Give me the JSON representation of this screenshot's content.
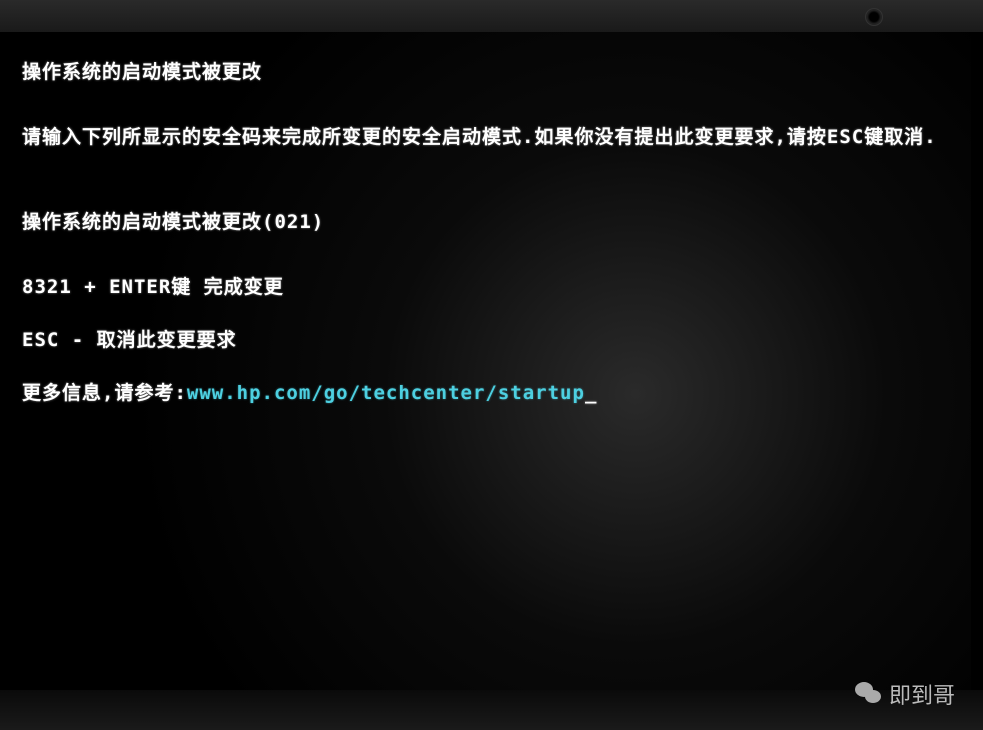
{
  "bios": {
    "title": "操作系统的启动模式被更改",
    "instruction": "请输入下列所显示的安全码来完成所变更的安全启动模式.如果你没有提出此变更要求,请按ESC键取消.",
    "status_line": "操作系统的启动模式被更改(021)",
    "confirm_action": "8321 + ENTER键  完成变更",
    "cancel_action": "ESC - 取消此变更要求",
    "more_info_label": "更多信息,请参考:",
    "more_info_url": "www.hp.com/go/techcenter/startup",
    "cursor": "_"
  },
  "watermark": {
    "text": "即到哥"
  }
}
